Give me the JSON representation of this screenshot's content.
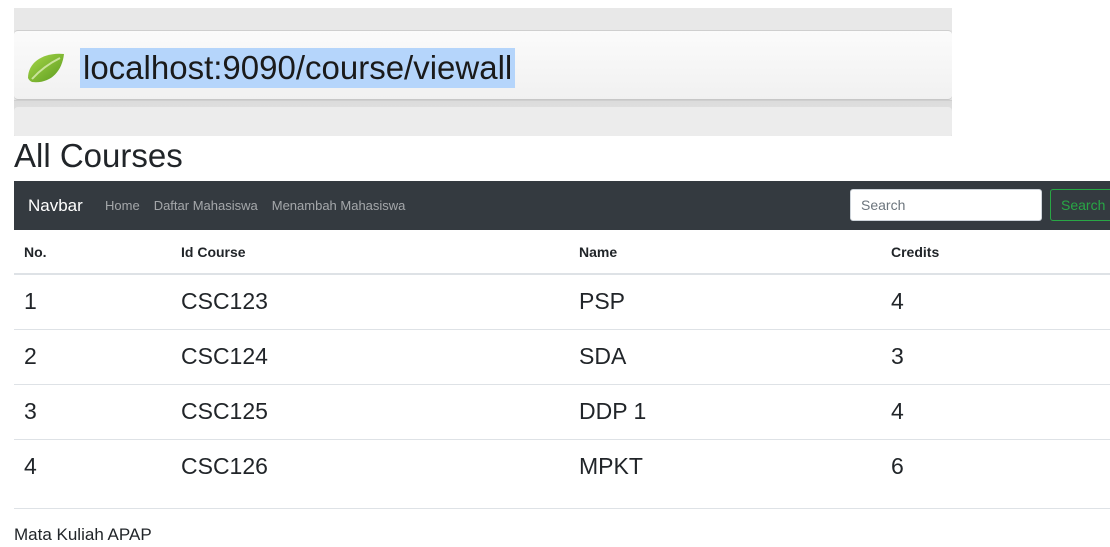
{
  "browser": {
    "url": "localhost:9090/course/viewall",
    "favicon_icon": "spring-leaf-icon"
  },
  "page": {
    "title": "All Courses"
  },
  "navbar": {
    "brand": "Navbar",
    "links": [
      "Home",
      "Daftar Mahasiswa",
      "Menambah Mahasiswa"
    ],
    "search_placeholder": "Search",
    "search_button": "Search",
    "search_button_color": "#28a745",
    "background": "#343a40"
  },
  "table": {
    "headers": [
      "No.",
      "Id Course",
      "Name",
      "Credits"
    ],
    "rows": [
      [
        "1",
        "CSC123",
        "PSP",
        "4"
      ],
      [
        "2",
        "CSC124",
        "SDA",
        "3"
      ],
      [
        "3",
        "CSC125",
        "DDP 1",
        "4"
      ],
      [
        "4",
        "CSC126",
        "MPKT",
        "6"
      ]
    ]
  },
  "footer": {
    "text": "Mata Kuliah APAP"
  }
}
